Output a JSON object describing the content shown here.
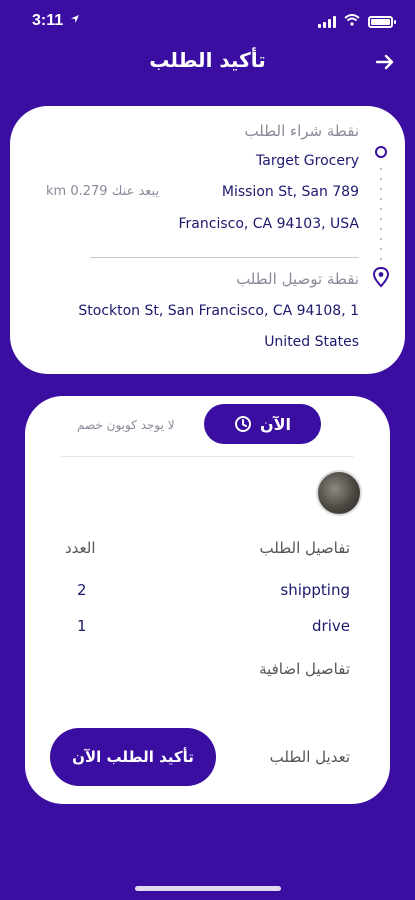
{
  "status_bar": {
    "time": "3:11"
  },
  "header": {
    "title": "تأكيد الطلب"
  },
  "route": {
    "pickup_label": "نقطة شراء الطلب",
    "pickup_name": "Target Grocery",
    "pickup_address_line1": "Mission St, San 789",
    "pickup_address_line2": "Francisco, CA 94103, USA",
    "distance": "يبعد عنك 0.279 km",
    "delivery_label": "نقطة توصيل الطلب",
    "delivery_address_line1": "Stockton St, San Francisco, CA  94108, 1",
    "delivery_address_line2": "United States"
  },
  "order": {
    "now_label": "الآن",
    "coupon": "لا يوجد كوبون خصم",
    "details_label": "تفاصيل الطلب",
    "count_label": "العدد",
    "items": [
      {
        "name": "shippting",
        "qty": "2"
      },
      {
        "name": "drive",
        "qty": "1"
      }
    ],
    "extra_details_label": "تفاصيل اضافية",
    "edit_label": "تعديل الطلب",
    "confirm_label": "تأكيد الطلب الآن"
  },
  "colors": {
    "primary": "#3a0ea0",
    "card": "#ffffff",
    "text": "#1d1a6e",
    "muted": "#8a8a9a"
  },
  "icons": [
    "location-arrow-icon",
    "wifi-icon",
    "battery-icon",
    "arrow-right-icon",
    "route-dot-icon",
    "location-pin-icon",
    "clock-icon"
  ]
}
